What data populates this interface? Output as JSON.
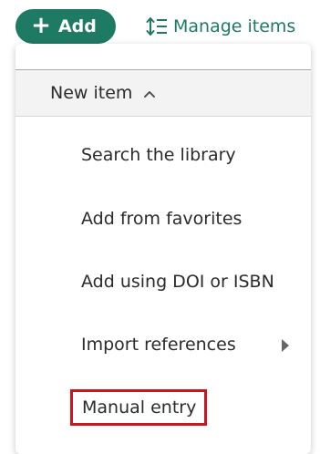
{
  "toolbar": {
    "add_label": "Add",
    "add_icon": "plus-icon",
    "manage_label": "Manage items",
    "manage_icon": "sort-list-icon"
  },
  "menu": {
    "header_label": "New item",
    "header_icon": "chevron-up-icon",
    "items": [
      {
        "label": "Search the library"
      },
      {
        "label": "Add from favorites"
      },
      {
        "label": "Add using DOI or ISBN"
      },
      {
        "label": "Import references",
        "icon": "caret-right-icon"
      },
      {
        "label": "Manual entry",
        "highlight_color": "#d0141f"
      }
    ]
  },
  "colors": {
    "accent": "#1f7a64",
    "highlight": "#d0141f"
  }
}
